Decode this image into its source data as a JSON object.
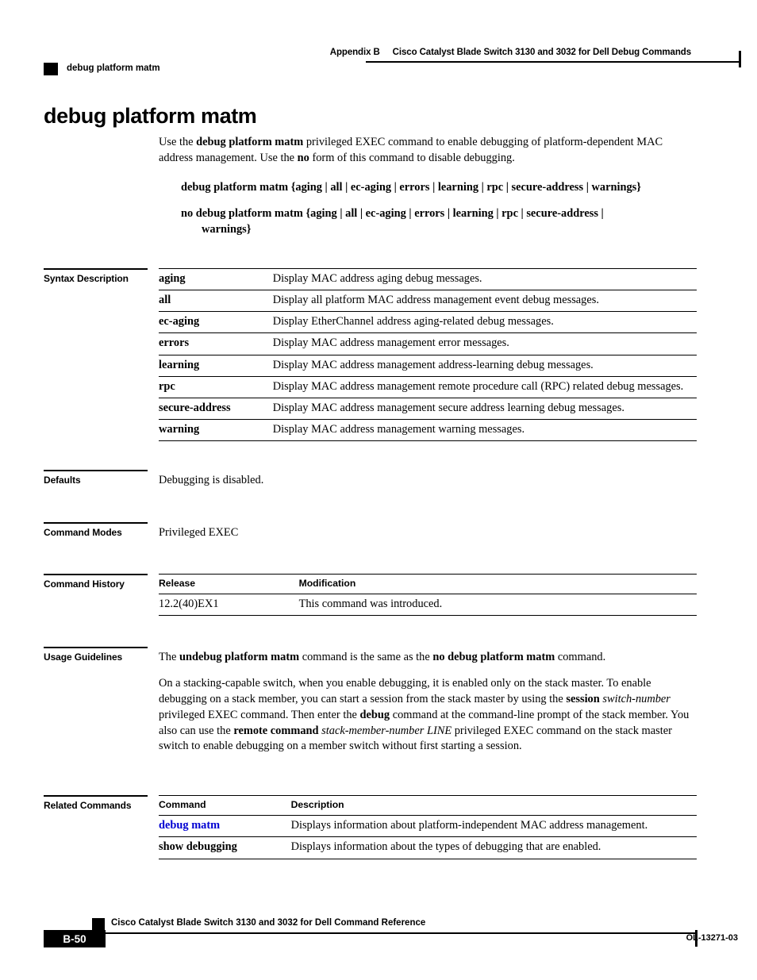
{
  "header": {
    "appendix": "Appendix B",
    "book_title": "Cisco Catalyst Blade Switch 3130 and 3032 for Dell Debug Commands",
    "running_command": "debug platform matm"
  },
  "title": "debug platform matm",
  "intro": {
    "line1_a": "Use the ",
    "line1_b": "debug platform matm",
    "line1_c": " privileged EXEC command to enable debugging of platform-dependent MAC address management. Use the ",
    "line1_d": "no",
    "line1_e": " form of this command to disable debugging."
  },
  "syntax_lines": {
    "positive": "debug platform matm {aging | all | ec-aging | errors | learning | rpc | secure-address | warnings}",
    "negative_line1": "no debug platform matm {aging | all | ec-aging | errors | learning | rpc | secure-address |",
    "negative_line2": "warnings}"
  },
  "sections": {
    "syntax_description": "Syntax Description",
    "defaults": "Defaults",
    "command_modes": "Command Modes",
    "command_history": "Command History",
    "usage_guidelines": "Usage Guidelines",
    "related_commands": "Related Commands"
  },
  "syntax_description_table": {
    "rows": [
      {
        "keyword": "aging",
        "description": "Display MAC address aging debug messages."
      },
      {
        "keyword": "all",
        "description": "Display all platform MAC address management event debug messages."
      },
      {
        "keyword": "ec-aging",
        "description": "Display EtherChannel address aging-related debug messages."
      },
      {
        "keyword": "errors",
        "description": "Display MAC address management error messages."
      },
      {
        "keyword": "learning",
        "description": "Display MAC address management address-learning debug messages."
      },
      {
        "keyword": "rpc",
        "description": "Display MAC address management remote procedure call (RPC) related debug messages."
      },
      {
        "keyword": "secure-address",
        "description": "Display MAC address management secure address learning debug messages."
      },
      {
        "keyword": "warning",
        "description": "Display MAC address management warning messages."
      }
    ]
  },
  "defaults_text": "Debugging is disabled.",
  "command_modes_text": "Privileged EXEC",
  "command_history_table": {
    "headers": {
      "col1": "Release",
      "col2": "Modification"
    },
    "rows": [
      {
        "release": "12.2(40)EX1",
        "modification": "This command was introduced."
      }
    ]
  },
  "usage_guidelines": {
    "p1_a": "The ",
    "p1_b": "undebug platform matm",
    "p1_c": " command is the same as the ",
    "p1_d": "no debug platform matm",
    "p1_e": " command.",
    "p2_a": "On a stacking-capable switch, when you enable debugging, it is enabled only on the stack master. To enable debugging on a stack member, you can start a session from the stack master by using the ",
    "p2_b": "session",
    "p2_c": " ",
    "p2_d": "switch-number",
    "p2_e": " privileged EXEC command. Then enter the ",
    "p2_f": "debug",
    "p2_g": " command at the command-line prompt of the stack member. You also can use the ",
    "p2_h": "remote command",
    "p2_i": " ",
    "p2_j": "stack-member-number LINE",
    "p2_k": " privileged EXEC command on the stack master switch to enable debugging on a member switch without first starting a session."
  },
  "related_commands_table": {
    "headers": {
      "col1": "Command",
      "col2": "Description"
    },
    "rows": [
      {
        "command": "debug matm",
        "is_link": "true",
        "description": "Displays information about platform-independent MAC address management."
      },
      {
        "command": "show debugging",
        "is_link": "false",
        "description": "Displays information about the types of debugging that are enabled."
      }
    ]
  },
  "footer": {
    "book_title": "Cisco Catalyst Blade Switch 3130 and 3032 for Dell Command Reference",
    "page_number": "B-50",
    "doc_id": "OL-13271-03"
  },
  "colors": {
    "link": "#0000D2",
    "rule": "#000000"
  }
}
